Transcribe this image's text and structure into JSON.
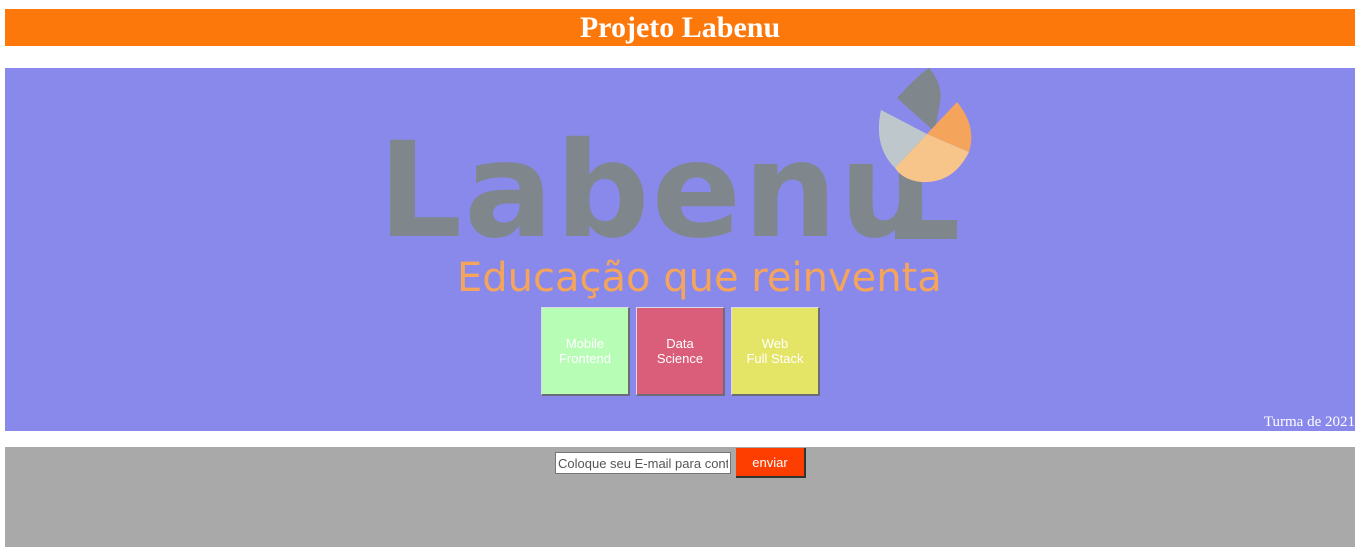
{
  "header": {
    "title": "Projeto Labenu"
  },
  "hero": {
    "logo": {
      "wordmark": "Labenu",
      "tagline": "Educação que reinventa",
      "colors": {
        "wordmark": "#7f878c",
        "tagline": "#f5a45c"
      }
    },
    "courses": [
      {
        "line1": "Mobile",
        "line2": "Frontend",
        "color": "#b8fdb6"
      },
      {
        "line1": "Data",
        "line2": "Science",
        "color": "#da5e7a"
      },
      {
        "line1": "Web",
        "line2": "Full Stack",
        "color": "#e4e466"
      }
    ],
    "footnote": "Turma de 2021"
  },
  "footer": {
    "email_placeholder": "Coloque seu E-mail para contato",
    "send_label": "enviar"
  },
  "colors": {
    "header_bg": "#fd780b",
    "hero_bg": "#8889eb",
    "footer_bg": "#a9a9a9",
    "button_bg": "#fe3d00"
  }
}
